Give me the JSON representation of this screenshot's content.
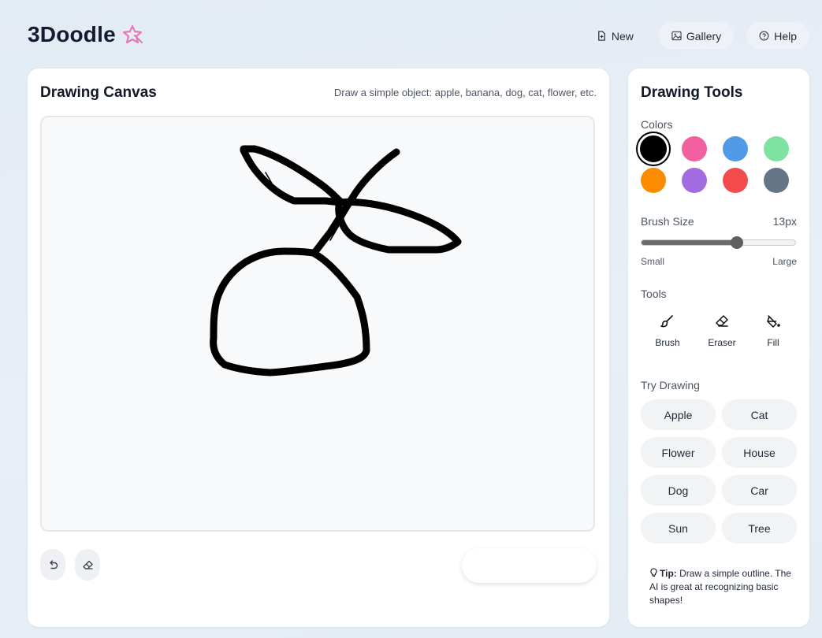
{
  "app": {
    "name": "3Doodle",
    "accent": "#e879b9"
  },
  "nav": {
    "new_label": "New",
    "gallery_label": "Gallery",
    "help_label": "Help"
  },
  "canvas": {
    "title": "Drawing Canvas",
    "hint": "Draw a simple object: apple, banana, dog, cat, flower, etc.",
    "background": "#f8f9fb",
    "stroke_color": "#000000"
  },
  "tools": {
    "title": "Drawing Tools",
    "colors_label": "Colors",
    "colors": [
      "#000000",
      "#f360a0",
      "#4f9be8",
      "#7ee3a0",
      "#fb8c00",
      "#a26bdf",
      "#f44b4b",
      "#667488"
    ],
    "selected_color": "#000000",
    "brush_size_label": "Brush Size",
    "brush_size_value": "13px",
    "brush_level": 0.62,
    "size_min_label": "Small",
    "size_max_label": "Large",
    "tools_label": "Tools",
    "tool_items": [
      {
        "label": "Brush",
        "icon": "brush-icon"
      },
      {
        "label": "Eraser",
        "icon": "eraser-icon"
      },
      {
        "label": "Fill",
        "icon": "paint-bucket-icon"
      }
    ],
    "try_label": "Try Drawing",
    "try_items": [
      "Apple",
      "Cat",
      "Flower",
      "House",
      "Dog",
      "Car",
      "Sun",
      "Tree"
    ],
    "tip_bold": "Tip:",
    "tip_text": "Draw a simple outline. The AI is great at recognizing basic shapes!"
  }
}
